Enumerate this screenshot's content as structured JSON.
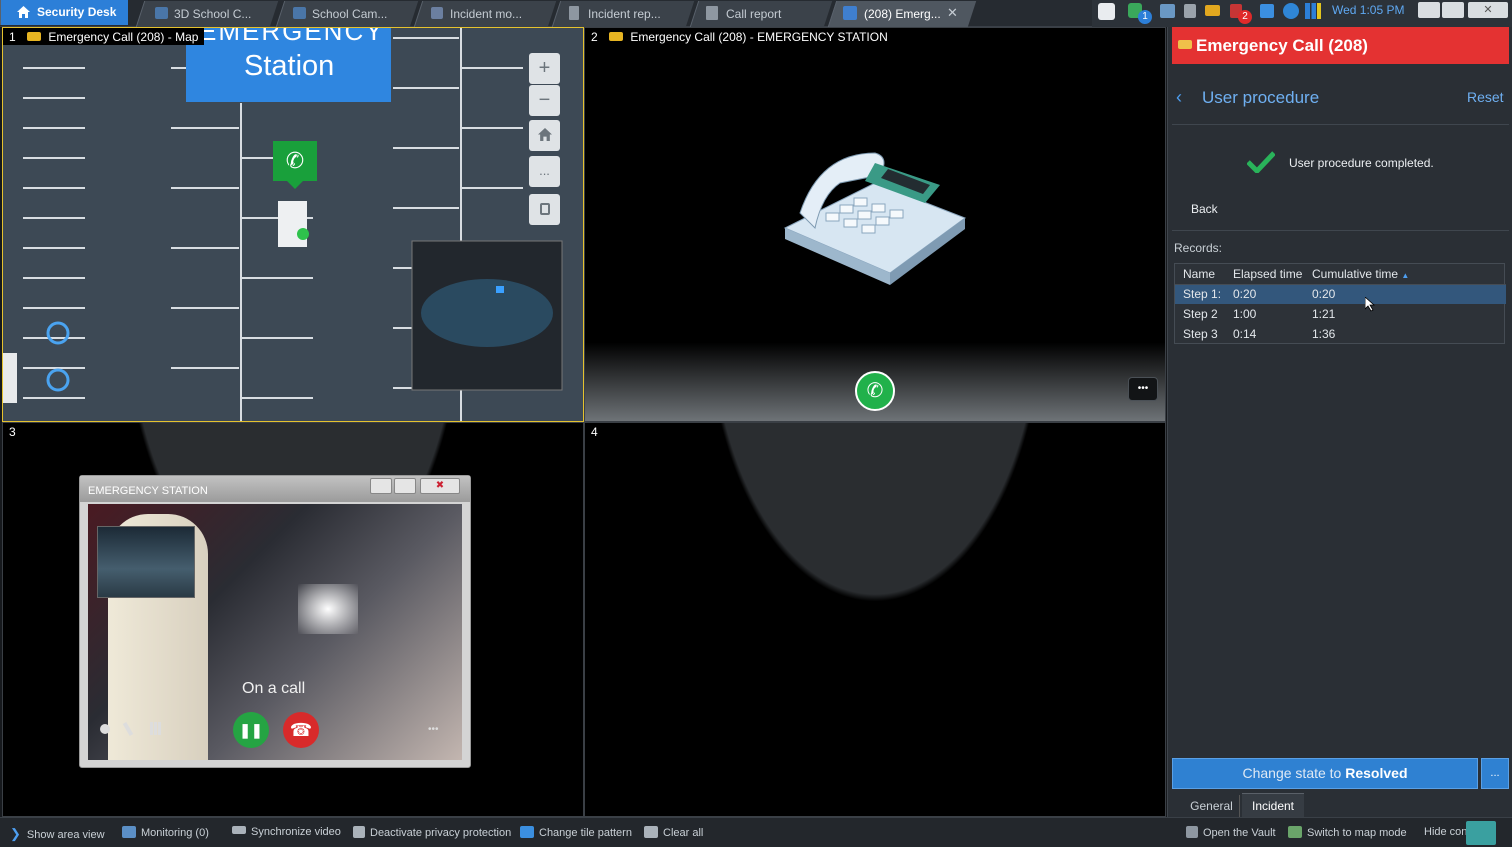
{
  "tabs": [
    {
      "label": "Security Desk",
      "icon": "home-icon"
    },
    {
      "label": "3D School C...",
      "icon": "monitor-icon"
    },
    {
      "label": "School Cam...",
      "icon": "monitor-icon"
    },
    {
      "label": "Incident mo...",
      "icon": "incident-icon"
    },
    {
      "label": "Incident rep...",
      "icon": "report-icon"
    },
    {
      "label": "Call report",
      "icon": "report-icon"
    },
    {
      "label": "(208) Emerg...",
      "icon": "emergency-icon"
    }
  ],
  "tray": {
    "clock": "Wed 1:05 PM",
    "badge1": "1",
    "badge2": "2"
  },
  "tiles": {
    "t1": {
      "num": "1",
      "title": "Emergency Call (208) - Map",
      "station_text": "Station",
      "station_top_text": "EMERGENCY"
    },
    "t2": {
      "num": "2",
      "title": "Emergency Call (208) - EMERGENCY STATION",
      "more": "•••"
    },
    "t3": {
      "num": "3",
      "window_title": "EMERGENCY STATION",
      "overlay_text": "On a call"
    },
    "t4": {
      "num": "4"
    }
  },
  "map_controls": {
    "zoom_in": "+",
    "zoom_out": "−",
    "more": "..."
  },
  "panel": {
    "title": "Emergency Call (208)",
    "section": "User procedure",
    "reset": "Reset",
    "completed": "User procedure completed.",
    "back": "Back",
    "records_label": "Records:",
    "columns": [
      "Name",
      "Elapsed time",
      "Cumulative time"
    ],
    "rows": [
      [
        "Step 1:",
        "0:20",
        "0:20"
      ],
      [
        "Step 2",
        "1:00",
        "1:21"
      ],
      [
        "Step 3",
        "0:14",
        "1:36"
      ]
    ],
    "change_state_prefix": "Change state to",
    "change_state_value": "Resolved",
    "change_more": "...",
    "tabs": [
      "General",
      "Incident"
    ]
  },
  "bottom_bar": [
    {
      "label": "Show area view",
      "icon": "chevron-right-icon"
    },
    {
      "label": "Monitoring (0)",
      "icon": "monitoring-icon"
    },
    {
      "label": "Synchronize video",
      "icon": "sync-icon"
    },
    {
      "label": "Deactivate privacy protection",
      "icon": "privacy-icon"
    },
    {
      "label": "Change tile pattern",
      "icon": "tile-pattern-icon"
    },
    {
      "label": "Clear all",
      "icon": "clear-icon"
    },
    {
      "label": "Open the Vault",
      "icon": "vault-icon"
    },
    {
      "label": "Switch to map mode",
      "icon": "map-mode-icon"
    },
    {
      "label": "Hide cont",
      "icon": "hide-icon"
    }
  ],
  "colors": {
    "accent": "#2c7fd8",
    "alert": "#e02a2a",
    "ok": "#2ecc71",
    "selected_row": "#33577c"
  }
}
